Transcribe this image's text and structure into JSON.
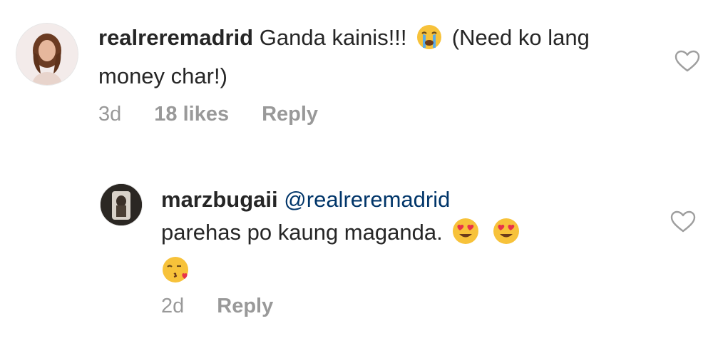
{
  "comments": [
    {
      "username": "realreremadrid",
      "text_before": "Ganda kainis!!!",
      "text_after": "(Need ko lang money char!)",
      "emojis": [
        "loudly-crying-face-emoji"
      ],
      "time": "3d",
      "likes": "18 likes",
      "reply_label": "Reply",
      "icon_like": "heart-outline-icon"
    },
    {
      "username": "marzbugaii",
      "mention": "@realreremadrid",
      "text": "parehas po kaung maganda.",
      "emojis": [
        "heart-eyes-emoji",
        "heart-eyes-emoji",
        "face-blowing-kiss-emoji"
      ],
      "time": "2d",
      "reply_label": "Reply",
      "icon_like": "heart-outline-icon"
    }
  ],
  "colors": {
    "text": "#262626",
    "meta": "#999999",
    "mention": "#003569"
  }
}
